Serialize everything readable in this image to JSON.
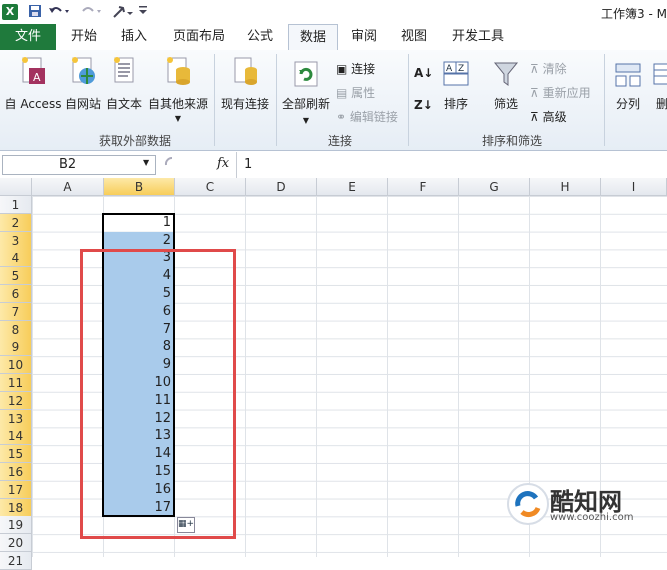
{
  "window": {
    "title": "工作簿3 - M"
  },
  "tabs": [
    {
      "label": "文件"
    },
    {
      "label": "开始"
    },
    {
      "label": "插入"
    },
    {
      "label": "页面布局"
    },
    {
      "label": "公式"
    },
    {
      "label": "数据"
    },
    {
      "label": "审阅"
    },
    {
      "label": "视图"
    },
    {
      "label": "开发工具"
    }
  ],
  "ribbon": {
    "get_external": {
      "group_label": "获取外部数据",
      "access": "自 Access",
      "web": "自网站",
      "text": "自文本",
      "other": "自其他来源",
      "existing": "现有连接"
    },
    "connections": {
      "group_label": "连接",
      "refresh_all": "全部刷新",
      "connections": "连接",
      "properties": "属性",
      "edit_links": "编辑链接"
    },
    "sort_filter": {
      "group_label": "排序和筛选",
      "sort": "排序",
      "filter": "筛选",
      "clear": "清除",
      "reapply": "重新应用",
      "advanced": "高级"
    },
    "data_tools": {
      "text_to_columns": "分列",
      "remove_dup": "删"
    }
  },
  "formula_bar": {
    "name_box": "B2",
    "fx": "fx",
    "value": "1"
  },
  "columns": [
    "A",
    "B",
    "C",
    "D",
    "E",
    "F",
    "G",
    "H",
    "I"
  ],
  "rows": [
    "1",
    "2",
    "3",
    "4",
    "5",
    "6",
    "7",
    "8",
    "9",
    "10",
    "11",
    "12",
    "13",
    "14",
    "15",
    "16",
    "17",
    "18",
    "19",
    "20",
    "21"
  ],
  "colB_values": [
    "",
    "1",
    "2",
    "3",
    "4",
    "5",
    "6",
    "7",
    "8",
    "9",
    "10",
    "11",
    "12",
    "13",
    "14",
    "15",
    "16",
    "17"
  ],
  "watermark": {
    "brand": "酷知网",
    "url": "www.coozhi.com"
  },
  "colors": {
    "file_tab": "#1f7a3c",
    "selection": "#a9cbeb",
    "highlight_box": "#e04a4a"
  }
}
